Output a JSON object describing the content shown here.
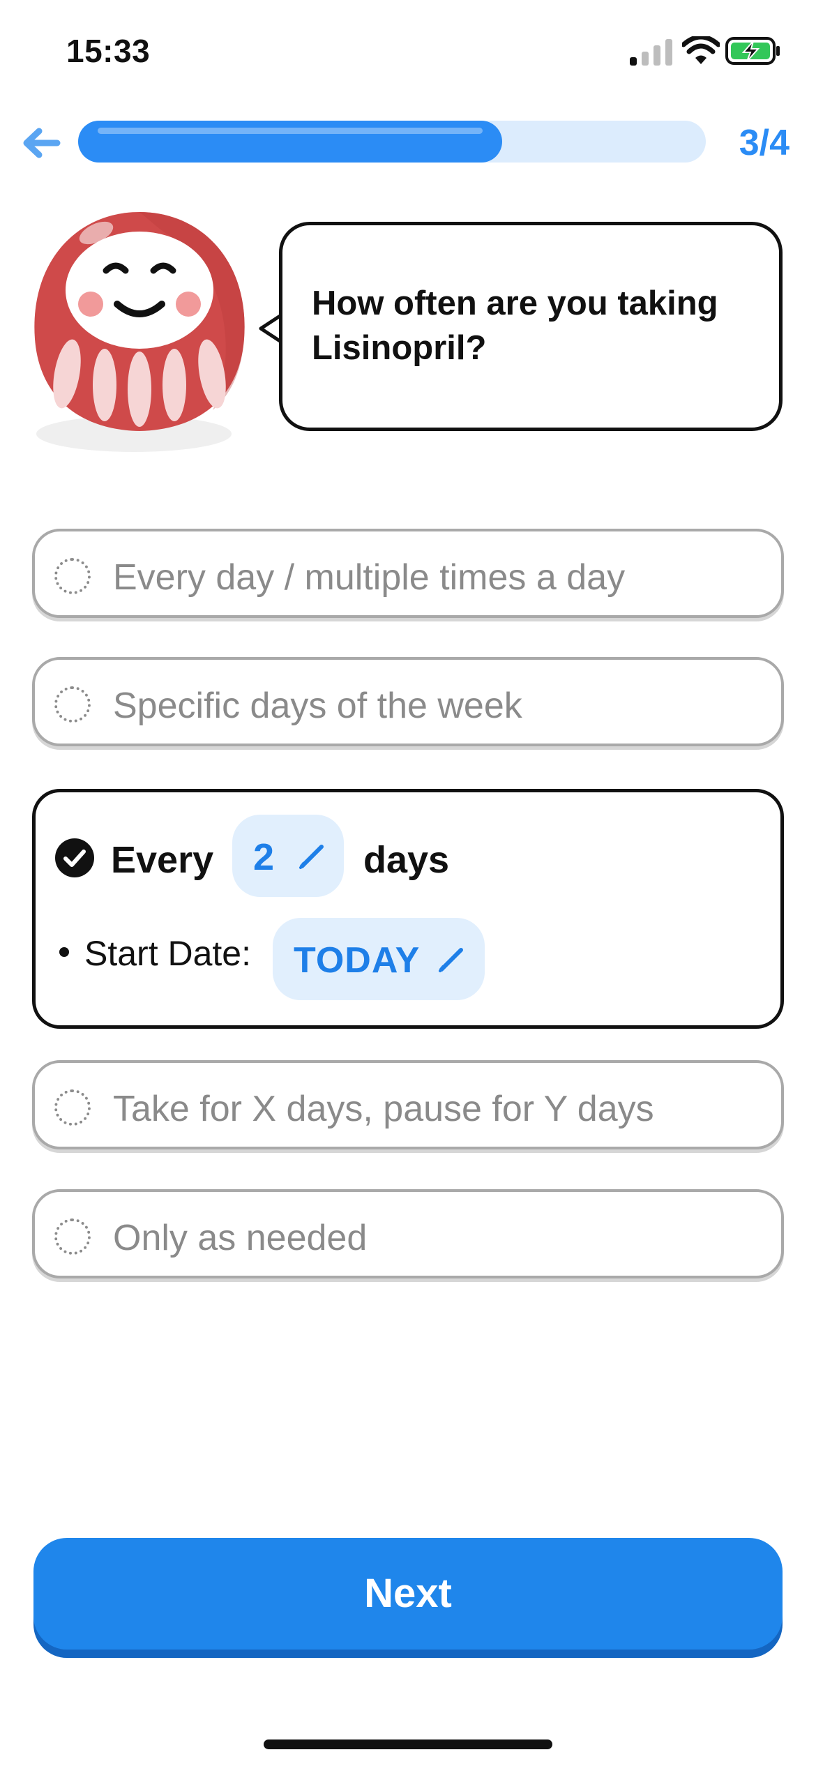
{
  "status_bar": {
    "time": "15:33",
    "signal_icon": "cellular-signal-icon",
    "wifi_icon": "wifi-icon",
    "battery_icon": "battery-charging-icon"
  },
  "header": {
    "back_icon": "arrow-left-icon",
    "progress_fraction": 0.75,
    "step_counter": "3/4"
  },
  "prompt": {
    "mascot": "daruma-mascot",
    "question": "How often are you taking Lisinopril?"
  },
  "options": [
    {
      "label": "Every day / multiple times a day",
      "selected": false
    },
    {
      "label": "Specific days of the week",
      "selected": false
    },
    {
      "selected": true,
      "every_label": "Every",
      "interval_value": "2",
      "days_label": "days",
      "start_date_label": "Start Date:",
      "start_date_value": "TODAY"
    },
    {
      "label": "Take for X days, pause for Y days",
      "selected": false
    },
    {
      "label": "Only as needed",
      "selected": false
    }
  ],
  "next_button": {
    "label": "Next"
  },
  "colors": {
    "accent": "#2b8cf5",
    "button": "#1f86eb",
    "chip_bg": "#e1effd",
    "mascot_red": "#cf4a4a"
  }
}
